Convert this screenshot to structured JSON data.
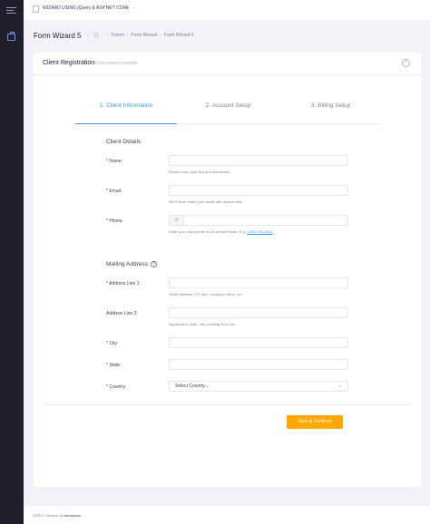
{
  "topbar": {
    "title": "WIZARD USING jQuery & ASP.NET CORE",
    "chevron": "⌄"
  },
  "subheader": {
    "page_title": "Form Wizard 5",
    "breadcrumb": [
      "Forms",
      "Form Wizard",
      "Form Wizard 5"
    ],
    "breadcrumb_sep": "›"
  },
  "card": {
    "title": "Client Registration",
    "subtitle": "Form wizard example",
    "help": "?"
  },
  "steps": [
    {
      "num": "1.",
      "label": "Client Information",
      "active": true
    },
    {
      "num": "2.",
      "label": "Account Setup",
      "active": false
    },
    {
      "num": "3.",
      "label": "Billing Setup",
      "active": false
    }
  ],
  "client_details": {
    "title": "Client Details",
    "name": {
      "label": "* Name:",
      "help": "Please enter your first and last names"
    },
    "email": {
      "label": "* Email:",
      "help": "We'll never share your email with anyone else"
    },
    "phone": {
      "label": "* Phone",
      "addon": "✆",
      "help_prefix": "Enter your valid phone in US phone format. E.g: ",
      "help_link": "1-541-754-3010"
    }
  },
  "mailing_address": {
    "title": "Mailing Address",
    "help_icon": "?",
    "address1": {
      "label": "* Address Line 1:",
      "help": "Street address, P.O. box, company name, c/o"
    },
    "address2": {
      "label": "Address Line 2:",
      "help": "Appartment, suite, unit, building, floor, etc"
    },
    "city": {
      "label": "* City:"
    },
    "state": {
      "label": "* State:"
    },
    "country": {
      "label": "* Country:",
      "selected": "Select Country...",
      "chevron": "⌄"
    }
  },
  "actions": {
    "continue_label": "Save & Continue"
  },
  "footer": {
    "prefix": "2020 © Wizards by ",
    "author": "farbahaan"
  },
  "colors": {
    "accent": "#3699ff",
    "button": "#ffa800",
    "sidebar": "#1e1e2d"
  }
}
